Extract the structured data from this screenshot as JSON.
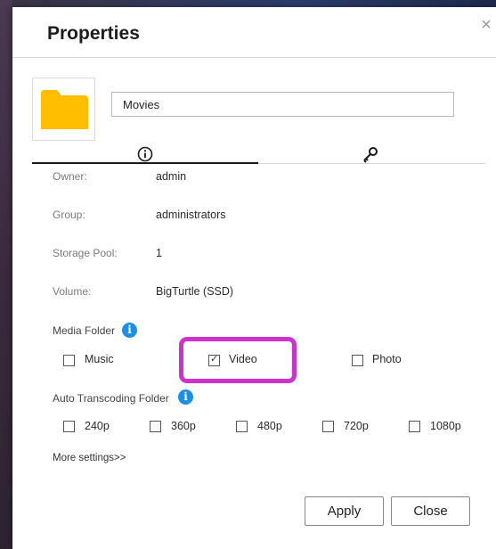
{
  "dialog": {
    "title": "Properties",
    "close_glyph": "×"
  },
  "folder": {
    "icon": "folder-icon",
    "icon_color": "#ffbf00",
    "name_value": "Movies"
  },
  "tabs": [
    {
      "name": "info",
      "icon": "info-circle-icon",
      "active": true
    },
    {
      "name": "permissions",
      "icon": "key-icon",
      "active": false
    }
  ],
  "details": {
    "owner_label": "Owner:",
    "owner_value": "admin",
    "group_label": "Group:",
    "group_value": "administrators",
    "pool_label": "Storage Pool:",
    "pool_value": "1",
    "volume_label": "Volume:",
    "volume_value": "BigTurtle (SSD)"
  },
  "media_folder": {
    "label": "Media Folder",
    "info_glyph": "i",
    "options": [
      {
        "label": "Music",
        "checked": false
      },
      {
        "label": "Video",
        "checked": true
      },
      {
        "label": "Photo",
        "checked": false
      }
    ]
  },
  "transcoding": {
    "label": "Auto Transcoding Folder",
    "info_glyph": "i",
    "options": [
      {
        "label": "240p",
        "checked": false
      },
      {
        "label": "360p",
        "checked": false
      },
      {
        "label": "480p",
        "checked": false
      },
      {
        "label": "720p",
        "checked": false
      },
      {
        "label": "1080p",
        "checked": false
      }
    ]
  },
  "more_settings": "More settings>>",
  "buttons": {
    "apply": "Apply",
    "close": "Close"
  },
  "colors": {
    "highlight": "#cc33cc",
    "info_blue": "#1a8fe3"
  }
}
